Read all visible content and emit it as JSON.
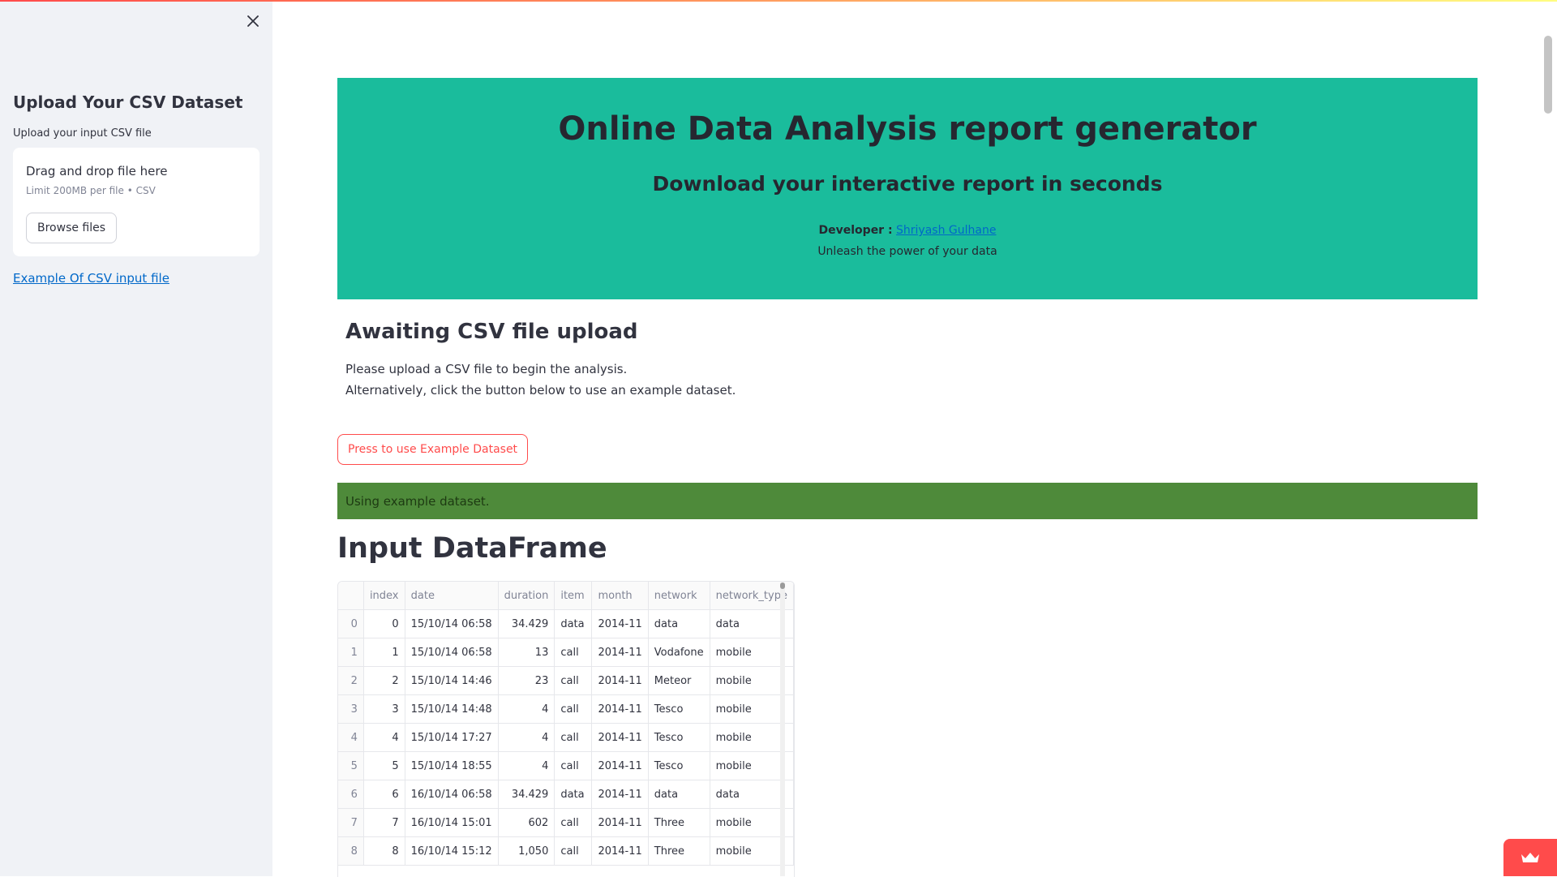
{
  "sidebar": {
    "title": "Upload Your CSV Dataset",
    "upload_label": "Upload your input CSV file",
    "dropzone_title": "Drag and drop file here",
    "dropzone_limit": "Limit 200MB per file • CSV",
    "browse_label": "Browse files",
    "example_link": "Example Of CSV input file",
    "close_icon": "close-icon"
  },
  "banner": {
    "title": "Online Data Analysis report generator",
    "subtitle": "Download your interactive report in seconds",
    "developer_label": "Developer :",
    "developer_name": "Shriyash Gulhane",
    "tagline": "Unleash the power of your data",
    "background_color": "#1abc9c"
  },
  "status": {
    "heading": "Awaiting CSV file upload",
    "line1": "Please upload a CSV file to begin the analysis.",
    "line2": "Alternatively, click the button below to use an example dataset.",
    "example_button": "Press to use Example Dataset",
    "success_message": "Using example dataset.",
    "success_color": "#4e8a3a"
  },
  "dataframe": {
    "heading": "Input DataFrame",
    "columns": [
      "",
      "index",
      "date",
      "duration",
      "item",
      "month",
      "network",
      "network_type"
    ],
    "rows": [
      [
        "0",
        "0",
        "15/10/14 06:58",
        "34.429",
        "data",
        "2014-11",
        "data",
        "data"
      ],
      [
        "1",
        "1",
        "15/10/14 06:58",
        "13",
        "call",
        "2014-11",
        "Vodafone",
        "mobile"
      ],
      [
        "2",
        "2",
        "15/10/14 14:46",
        "23",
        "call",
        "2014-11",
        "Meteor",
        "mobile"
      ],
      [
        "3",
        "3",
        "15/10/14 14:48",
        "4",
        "call",
        "2014-11",
        "Tesco",
        "mobile"
      ],
      [
        "4",
        "4",
        "15/10/14 17:27",
        "4",
        "call",
        "2014-11",
        "Tesco",
        "mobile"
      ],
      [
        "5",
        "5",
        "15/10/14 18:55",
        "4",
        "call",
        "2014-11",
        "Tesco",
        "mobile"
      ],
      [
        "6",
        "6",
        "16/10/14 06:58",
        "34.429",
        "data",
        "2014-11",
        "data",
        "data"
      ],
      [
        "7",
        "7",
        "16/10/14 15:01",
        "602",
        "call",
        "2014-11",
        "Three",
        "mobile"
      ],
      [
        "8",
        "8",
        "16/10/14 15:12",
        "1,050",
        "call",
        "2014-11",
        "Three",
        "mobile"
      ]
    ]
  },
  "accent_color": "#ff4b4b"
}
